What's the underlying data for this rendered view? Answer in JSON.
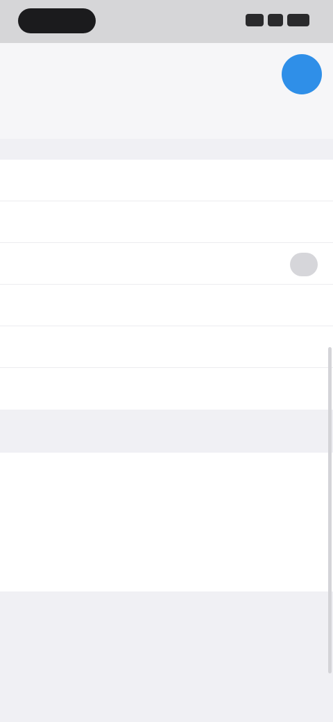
{
  "header": {
    "title": "",
    "tabs": [
      {
        "label": ""
      },
      {
        "label": ""
      },
      {
        "label": ""
      },
      {
        "label": ""
      }
    ]
  },
  "section_top": {
    "label": ""
  },
  "rows": [
    {
      "label": "",
      "value": ""
    },
    {
      "label": "",
      "value": ""
    },
    {
      "label": "",
      "value": ""
    },
    {
      "label": "",
      "value": ""
    },
    {
      "label": "",
      "value": ""
    },
    {
      "label": "",
      "value": ""
    }
  ],
  "section_bottom": {
    "label": ""
  },
  "about": {
    "line1": "",
    "line2": "",
    "line3": ""
  },
  "colors": {
    "accent": "#2f8fe8",
    "background": "#f0f0f4",
    "card": "#ffffff"
  }
}
